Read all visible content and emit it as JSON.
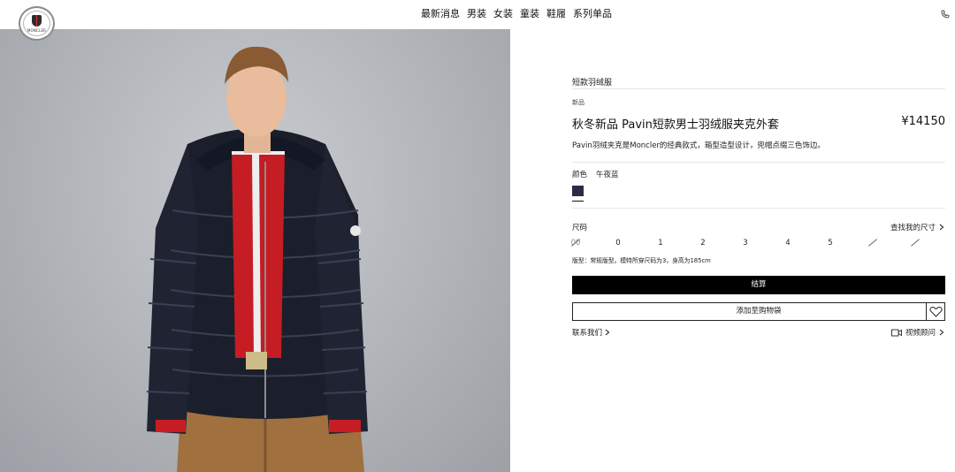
{
  "brand": {
    "logo_text": "MONCLER"
  },
  "nav": {
    "items": [
      "最新消息",
      "男装",
      "女装",
      "童装",
      "鞋履",
      "系列单品"
    ]
  },
  "icons": {
    "phone": "phone-icon",
    "heart": "heart-icon",
    "video": "video-camera-icon",
    "chevron": "chevron-right-icon"
  },
  "product": {
    "category": "短款羽绒服",
    "badge": "新品",
    "title": "秋冬新品 Pavin短款男士羽绒服夹克外套",
    "price": "¥14150",
    "description": "Pavin羽绒夹克是Moncler的经典款式，箱型造型设计，兜帽点缀三色饰边。",
    "color_label": "颜色",
    "color_name": "午夜蓝",
    "swatch_color": "#2a2b44",
    "size_label": "尺码",
    "size_guide": "查找我的尺寸",
    "sizes": [
      {
        "label": "00",
        "available": false
      },
      {
        "label": "0",
        "available": true
      },
      {
        "label": "1",
        "available": true
      },
      {
        "label": "2",
        "available": true
      },
      {
        "label": "3",
        "available": true
      },
      {
        "label": "4",
        "available": true
      },
      {
        "label": "5",
        "available": true
      },
      {
        "label": "",
        "available": false
      },
      {
        "label": "",
        "available": false
      }
    ],
    "fit_note": "版型：常规版型。模特所穿尺码为3，身高为185cm",
    "checkout": "结算",
    "add_to_bag": "添加至购物袋",
    "contact": "联系我们",
    "video_consult": "视频顾问"
  }
}
